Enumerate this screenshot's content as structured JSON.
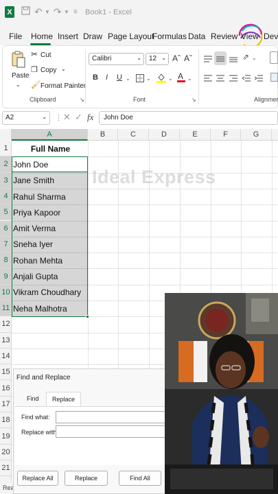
{
  "title_bar": {
    "app_initial": "X",
    "document_title": "Book1 - Excel"
  },
  "menu": {
    "items": [
      "File",
      "Home",
      "Insert",
      "Draw",
      "Page Layout",
      "Formulas",
      "Data",
      "Review",
      "View",
      "Deve"
    ],
    "active": "Home"
  },
  "ribbon": {
    "clipboard": {
      "paste": "Paste",
      "cut": "Cut",
      "copy": "Copy",
      "format_painter": "Format Painter",
      "group_label": "Clipboard"
    },
    "font": {
      "font_name": "Calibri",
      "font_size": "12",
      "bold": "B",
      "italic": "I",
      "underline": "U",
      "grow": "Aˆ",
      "shrink": "Aˇ",
      "group_label": "Font"
    },
    "alignment": {
      "group_label": "Alignment"
    }
  },
  "formula_bar": {
    "name_box": "A2",
    "fx_label": "fx",
    "content": "John Doe"
  },
  "grid": {
    "columns": [
      "A",
      "B",
      "C",
      "D",
      "E",
      "F",
      "G"
    ],
    "rows": [
      "1",
      "2",
      "3",
      "4",
      "5",
      "6",
      "7",
      "8",
      "9",
      "10",
      "11",
      "12",
      "13",
      "14",
      "15",
      "16",
      "17",
      "18",
      "19",
      "20",
      "21"
    ],
    "selected_column": "A",
    "header": "Full Name",
    "names": [
      "John Doe",
      "Jane Smith",
      "Rahul Sharma",
      "Priya Kapoor",
      "Amit Verma",
      "Sneha Iyer",
      "Rohan Mehta",
      "Anjali Gupta",
      "Vikram Choudhary",
      "Neha Malhotra"
    ]
  },
  "watermark": "Ideal Express",
  "dialog": {
    "title": "Find and Replace",
    "tabs": [
      "Find",
      "Replace"
    ],
    "active_tab": "Replace",
    "find_what_label": "Find what:",
    "find_what_value": "",
    "replace_with_label": "Replace with:",
    "replace_with_value": "",
    "buttons": [
      "Replace All",
      "Replace",
      "Find All"
    ]
  },
  "status_bar": {
    "text": "Ready"
  },
  "colors": {
    "excel_green": "#107c41",
    "selection_fill": "#d2d2d2"
  }
}
